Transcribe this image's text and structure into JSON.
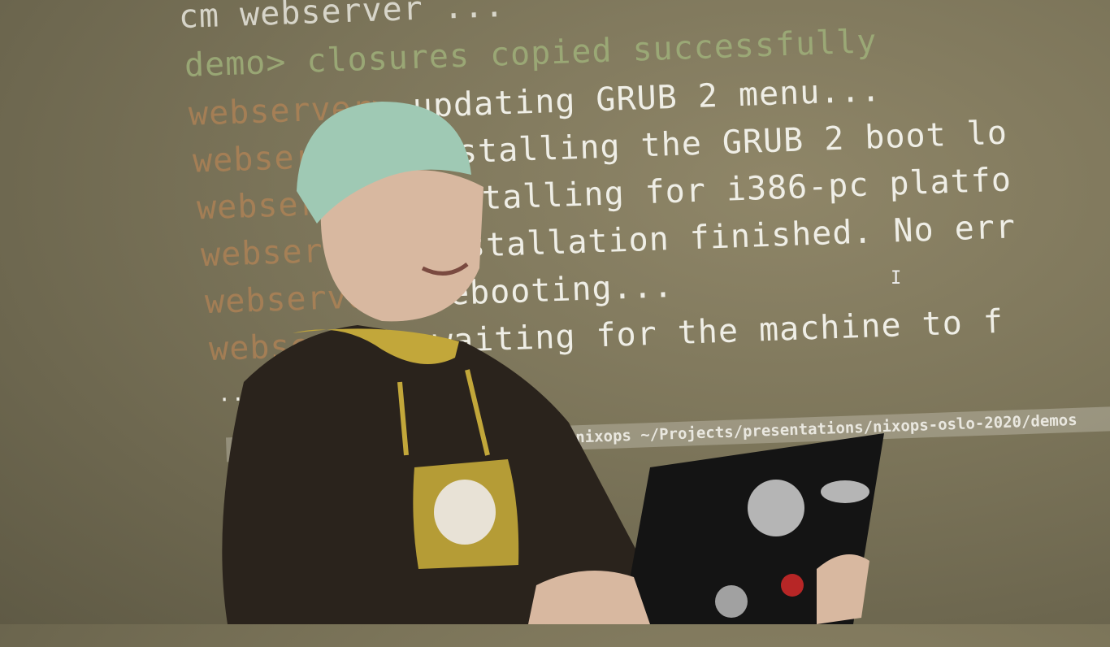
{
  "terminal": {
    "top_line": "cm webserver ...",
    "lines": [
      {
        "prompt": "demo>",
        "text": "closures copied successfully"
      },
      {
        "prompt": "webserver>",
        "text": "updating GRUB 2 menu..."
      },
      {
        "prompt": "webserver>",
        "text": "installing the GRUB 2 boot lo"
      },
      {
        "prompt": "webserver>",
        "text": "Installing for i386-pc platfo"
      },
      {
        "prompt": "webserver>",
        "text": "Installation finished. No err"
      },
      {
        "prompt": "webserver>",
        "text": "rebooting..."
      },
      {
        "prompt": "webserver>",
        "text": "waiting for the machine to f"
      }
    ],
    "ellipsis": "...",
    "status_bar": "nixops ~/Projects/presentations/nixops-oslo-2020/demos",
    "cursor": "I"
  },
  "colors": {
    "hair": "#9fc9b4",
    "hoodie": "#2a231c",
    "laptop": "#141414",
    "yellow": "#c2a73a"
  }
}
